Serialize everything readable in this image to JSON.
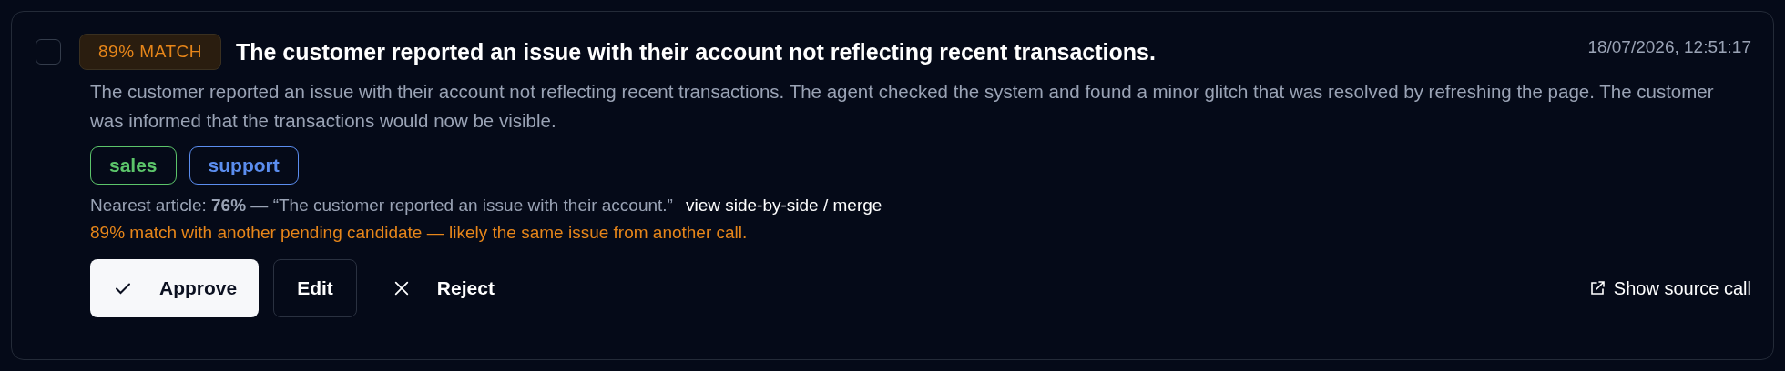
{
  "candidate": {
    "checked": false,
    "match_badge": "89% MATCH",
    "title": "The customer reported an issue with their account not reflecting recent transactions.",
    "timestamp": "18/07/2026, 12:51:17",
    "summary": "The customer reported an issue with their account not reflecting recent transactions. The agent checked the system and found a minor glitch that was resolved by refreshing the page. The customer was informed that the transactions would now be visible.",
    "tags": [
      {
        "label": "sales",
        "color": "#5cc46a"
      },
      {
        "label": "support",
        "color": "#5b8def"
      }
    ],
    "nearest_article": "Nearest article: **76%** — “The customer reported an issue with their account.”",
    "merge_link": "view side-by-side / merge",
    "duplicate_warning": "89% match with another pending candidate — likely the same issue from another call.",
    "actions": [
      {
        "kind": "approve",
        "label": "Approve"
      },
      {
        "kind": "edit",
        "label": "Edit"
      },
      {
        "kind": "reject",
        "label": "Reject"
      }
    ],
    "source_link": "Show source call"
  }
}
